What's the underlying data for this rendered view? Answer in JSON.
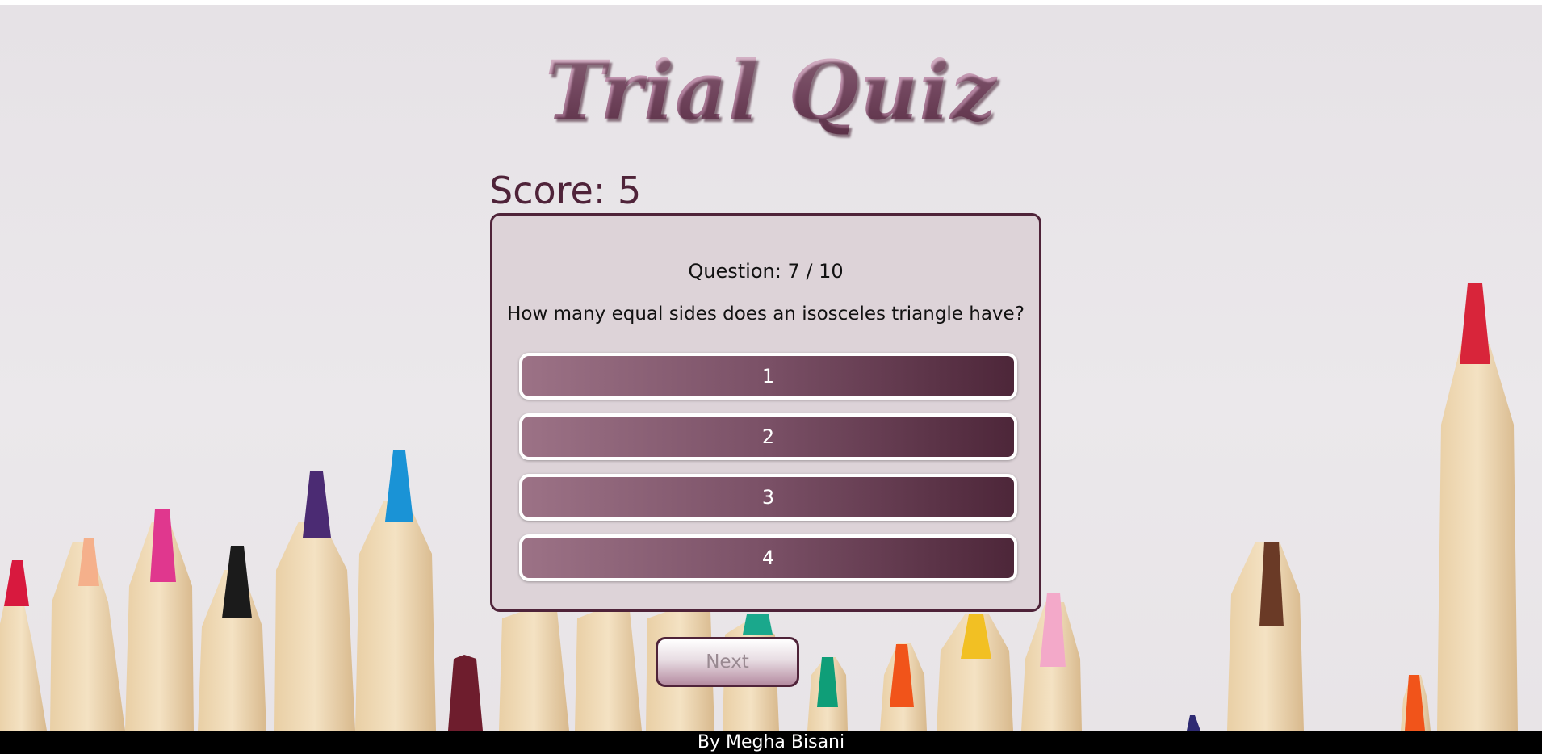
{
  "header": {
    "title": "Trial Quiz"
  },
  "score": {
    "label": "Score: 5"
  },
  "question": {
    "counter": "Question: 7 / 10",
    "text": "How many equal sides does an isosceles triangle have?"
  },
  "answers": [
    {
      "label": "1"
    },
    {
      "label": "2"
    },
    {
      "label": "3"
    },
    {
      "label": "4"
    }
  ],
  "next": {
    "label": "Next",
    "disabled": true
  },
  "footer": {
    "text": "By Megha Bisani"
  },
  "colors": {
    "accent_dark": "#4f2339",
    "card_bg": "#ddd3d8",
    "answer_gradient_start": "#9c7286",
    "answer_gradient_end": "#4d2639",
    "footer_bg": "#000000"
  }
}
